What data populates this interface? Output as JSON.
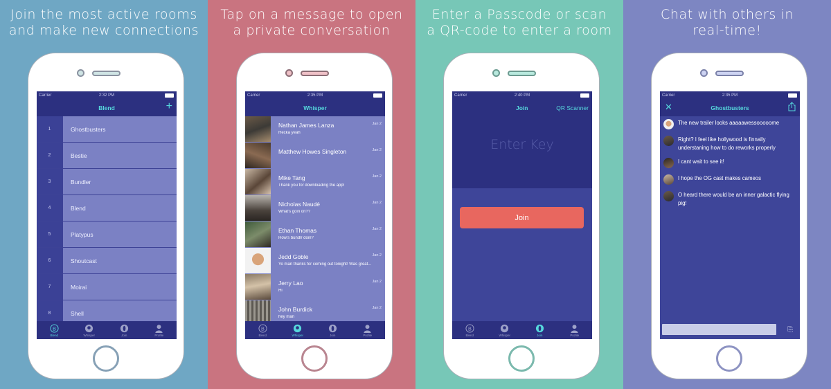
{
  "colors": {
    "panel1_bg": "#6fa7c4",
    "panel2_bg": "#c97480",
    "panel3_bg": "#77c7b7",
    "panel4_bg": "#7d86c2",
    "nav_bg": "#2c3080",
    "accent": "#56d7dc",
    "list_bg": "#7b81c4",
    "join_button": "#e8675f"
  },
  "status": {
    "carrier": "Carrier",
    "time1": "2:32 PM",
    "time2": "2:35 PM",
    "time3": "2:40 PM",
    "time4": "2:35 PM"
  },
  "tabs": [
    {
      "label": "Blend",
      "icon": "blend-b-icon"
    },
    {
      "label": "Whisper",
      "icon": "whisper-bubble-icon"
    },
    {
      "label": "Join",
      "icon": "join-ring-icon"
    },
    {
      "label": "Profile",
      "icon": "profile-person-icon"
    }
  ],
  "panel1": {
    "caption": [
      "Join the most active rooms",
      "and make new connections"
    ],
    "nav_title": "Blend",
    "add_icon": "+",
    "rooms": [
      {
        "num": "1",
        "name": "Ghostbusters"
      },
      {
        "num": "2",
        "name": "Bestie"
      },
      {
        "num": "3",
        "name": "Bundler"
      },
      {
        "num": "4",
        "name": "Blend"
      },
      {
        "num": "5",
        "name": "Platypus"
      },
      {
        "num": "6",
        "name": "Shoutcast"
      },
      {
        "num": "7",
        "name": "Moirai"
      },
      {
        "num": "8",
        "name": "Shell"
      }
    ]
  },
  "panel2": {
    "caption": [
      "Tap on a message to open",
      "a private conversation"
    ],
    "nav_title": "Whisper",
    "messages": [
      {
        "name": "Nathan James Lanza",
        "text": "Hecka yeah",
        "date": "Jan 2"
      },
      {
        "name": "Matthew Howes Singleton",
        "text": "",
        "date": "Jan 2"
      },
      {
        "name": "Mike Tang",
        "text": "Thank you for downloading the app!",
        "date": "Jan 2"
      },
      {
        "name": "Nicholas Naudé",
        "text": "What's goin on??",
        "date": "Jan 2"
      },
      {
        "name": "Ethan Thomas",
        "text": "How's bundlr doin?",
        "date": "Jan 2"
      },
      {
        "name": "Jedd Goble",
        "text": "Yo man thanks for coming out tonight! Was great...",
        "date": "Jan 2"
      },
      {
        "name": "Jerry Lao",
        "text": "Hi",
        "date": "Jan 2"
      },
      {
        "name": "John Burdick",
        "text": "hey man",
        "date": "Jan 2"
      }
    ]
  },
  "panel3": {
    "caption": [
      "Enter a Passcode or scan",
      "a QR-code to enter a room"
    ],
    "tab_join": "Join",
    "tab_qr": "QR Scanner",
    "key_placeholder": "Enter Key",
    "join_button": "Join"
  },
  "panel4": {
    "caption": [
      "Chat with others in",
      "real-time!"
    ],
    "nav_title": "Ghostbusters",
    "messages": [
      {
        "text": "The new trailer looks aaaaawessooooome"
      },
      {
        "text": "Right? I feel like hollywood is finnally understaning how to do reworks properly"
      },
      {
        "text": "I cant wait to see it!"
      },
      {
        "text": "I hope the OG cast makes cameos"
      },
      {
        "text": "O heard there would be an inner galactic flying pig!"
      }
    ]
  }
}
